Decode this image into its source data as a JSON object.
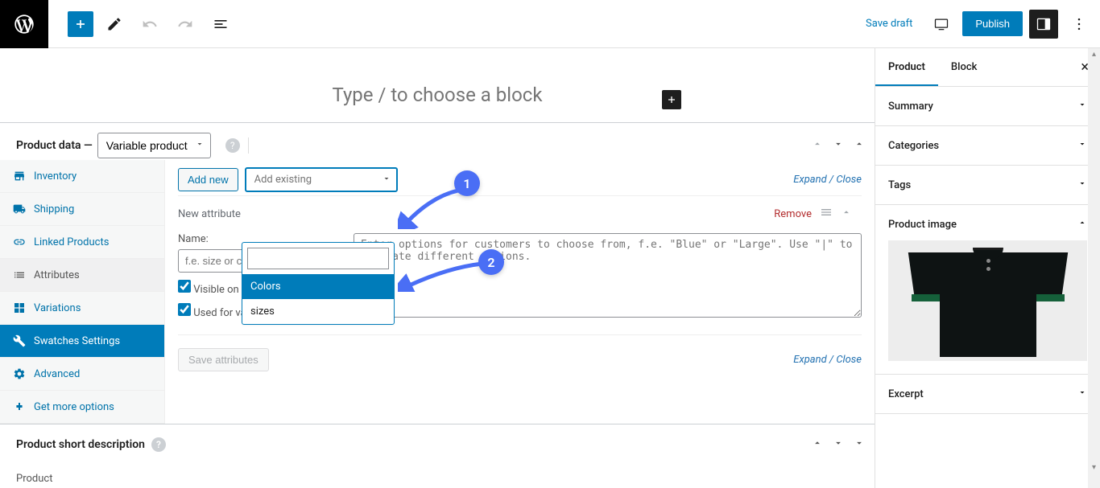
{
  "toolbar": {
    "saveDraft": "Save draft",
    "publish": "Publish"
  },
  "editor": {
    "blockPrompt": "Type / to choose a block"
  },
  "productData": {
    "label": "Product data —",
    "typeSelected": "Variable product",
    "tabs": {
      "inventory": "Inventory",
      "shipping": "Shipping",
      "linked": "Linked Products",
      "attributes": "Attributes",
      "variations": "Variations",
      "swatches": "Swatches Settings",
      "advanced": "Advanced",
      "more": "Get more options"
    },
    "addNew": "Add new",
    "addExistingPlaceholder": "Add existing",
    "expandCollapse": "Expand / Close",
    "dropdown": {
      "option1": "Colors",
      "option2": "sizes"
    },
    "newAttributeLabel": "New attribute",
    "removeLabel": "Remove",
    "nameLabel": "Name:",
    "namePlaceholder": "f.e. size or color",
    "valuesPlaceholder": "Enter options for customers to choose from, f.e. \"Blue\" or \"Large\". Use \"|\" to separate different options.",
    "visibleLabel": "Visible on the product page",
    "usedLabel": "Used for variations",
    "saveAttributes": "Save attributes"
  },
  "shortDesc": {
    "title": "Product short description"
  },
  "footerLabel": "Product",
  "sidebar": {
    "tabProduct": "Product",
    "tabBlock": "Block",
    "panels": {
      "summary": "Summary",
      "categories": "Categories",
      "tags": "Tags",
      "productImage": "Product image",
      "excerpt": "Excerpt"
    }
  },
  "callouts": {
    "one": "1",
    "two": "2"
  }
}
